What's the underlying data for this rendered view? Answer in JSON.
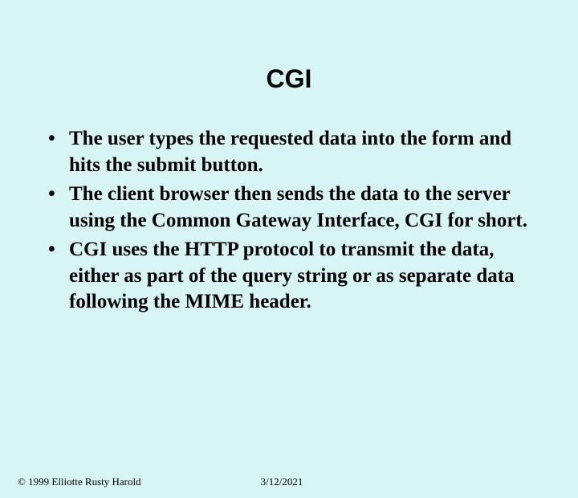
{
  "title": "CGI",
  "bullets": [
    "The user types the requested data into the form and hits the submit button.",
    "The client browser then sends the data to the server using the Common Gateway Interface, CGI for short.",
    "CGI uses the HTTP protocol to transmit the data, either as part of the query string or as separate data following the MIME header."
  ],
  "footer": {
    "copyright": "© 1999 Elliotte Rusty Harold",
    "date": "3/12/2021"
  }
}
